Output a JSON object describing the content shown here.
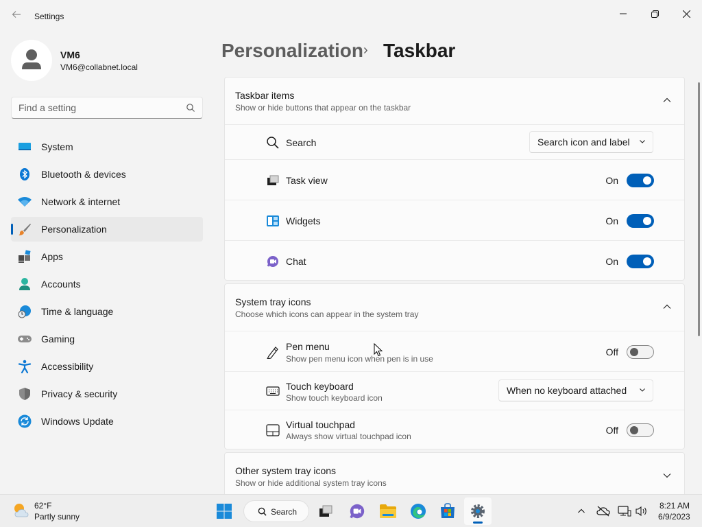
{
  "window": {
    "title": "Settings"
  },
  "profile": {
    "name": "VM6",
    "email": "VM6@collabnet.local"
  },
  "search": {
    "placeholder": "Find a setting"
  },
  "nav": {
    "items": [
      {
        "label": "System"
      },
      {
        "label": "Bluetooth & devices"
      },
      {
        "label": "Network & internet"
      },
      {
        "label": "Personalization"
      },
      {
        "label": "Apps"
      },
      {
        "label": "Accounts"
      },
      {
        "label": "Time & language"
      },
      {
        "label": "Gaming"
      },
      {
        "label": "Accessibility"
      },
      {
        "label": "Privacy & security"
      },
      {
        "label": "Windows Update"
      }
    ]
  },
  "breadcrumb": {
    "parent": "Personalization",
    "separator": "›",
    "current": "Taskbar"
  },
  "taskbar_items": {
    "title": "Taskbar items",
    "desc": "Show or hide buttons that appear on the taskbar",
    "search": {
      "label": "Search",
      "value": "Search icon and label"
    },
    "task_view": {
      "label": "Task view",
      "state": "On"
    },
    "widgets": {
      "label": "Widgets",
      "state": "On"
    },
    "chat": {
      "label": "Chat",
      "state": "On"
    }
  },
  "system_tray": {
    "title": "System tray icons",
    "desc": "Choose which icons can appear in the system tray",
    "pen_menu": {
      "label": "Pen menu",
      "sub": "Show pen menu icon when pen is in use",
      "state": "Off"
    },
    "touch_keyboard": {
      "label": "Touch keyboard",
      "sub": "Show touch keyboard icon",
      "value": "When no keyboard attached"
    },
    "virtual_touchpad": {
      "label": "Virtual touchpad",
      "sub": "Always show virtual touchpad icon",
      "state": "Off"
    }
  },
  "other_tray": {
    "title": "Other system tray icons",
    "desc": "Show or hide additional system tray icons"
  },
  "taskbar": {
    "weather": {
      "temp": "62°F",
      "desc": "Partly sunny"
    },
    "search_label": "Search",
    "time": "8:21 AM",
    "date": "6/9/2023"
  },
  "colors": {
    "accent": "#005fb8"
  }
}
